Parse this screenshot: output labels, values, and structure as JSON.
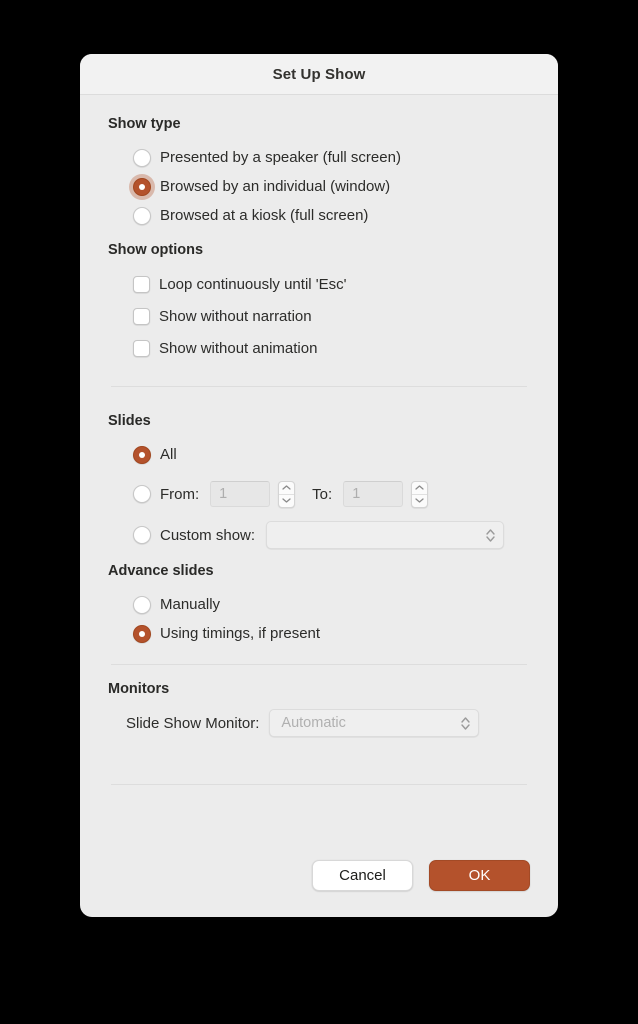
{
  "dialog": {
    "title": "Set Up Show"
  },
  "show_type": {
    "heading": "Show type",
    "options": [
      {
        "label": "Presented by a speaker (full screen)",
        "selected": false
      },
      {
        "label": "Browsed by an individual (window)",
        "selected": true
      },
      {
        "label": "Browsed at a kiosk (full screen)",
        "selected": false
      }
    ]
  },
  "show_options": {
    "heading": "Show options",
    "options": [
      {
        "label": "Loop continuously until 'Esc'",
        "checked": false
      },
      {
        "label": "Show without narration",
        "checked": false
      },
      {
        "label": "Show without animation",
        "checked": false
      }
    ]
  },
  "slides": {
    "heading": "Slides",
    "all_label": "All",
    "from_label": "From:",
    "from_value": "1",
    "to_label": "To:",
    "to_value": "1",
    "custom_show_label": "Custom show:",
    "custom_show_value": ""
  },
  "advance_slides": {
    "heading": "Advance slides",
    "options": [
      {
        "label": "Manually",
        "selected": false
      },
      {
        "label": "Using timings, if present",
        "selected": true
      }
    ]
  },
  "monitors": {
    "heading": "Monitors",
    "monitor_label": "Slide Show Monitor:",
    "monitor_value": "Automatic"
  },
  "footer": {
    "cancel_label": "Cancel",
    "ok_label": "OK"
  },
  "colors": {
    "accent": "#b4522c",
    "dialog_bg": "#ececec",
    "titlebar_bg": "#f2f2f2"
  }
}
